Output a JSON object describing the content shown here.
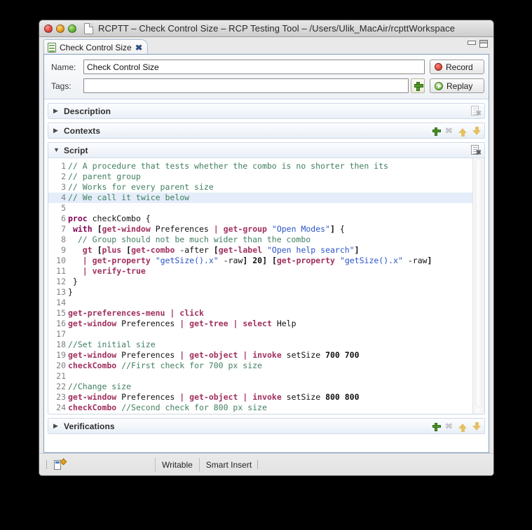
{
  "window": {
    "title": "RCPTT – Check Control Size – RCP Testing Tool – /Users/Ulik_MacAir/rcpttWorkspace",
    "doc_icon": "document-icon",
    "traffic_lights": [
      "close-button",
      "minimize-button",
      "maximize-button"
    ]
  },
  "tab": {
    "label": "Check Control Size",
    "icon": "test-case-document-icon",
    "close": "✖",
    "minimize_icon": "minimize-icon",
    "maximize_icon": "maximize-icon"
  },
  "form": {
    "name_label": "Name:",
    "name_value": "Check Control Size",
    "name_placeholder": "",
    "tags_label": "Tags:",
    "tags_value": "",
    "tags_placeholder": "",
    "add_tag_icon": "plus-icon",
    "record_label": "Record",
    "replay_label": "Replay"
  },
  "sections": [
    {
      "id": "description",
      "title": "Description",
      "expanded": false,
      "twisty": "▶"
    },
    {
      "id": "contexts",
      "title": "Contexts",
      "expanded": false,
      "twisty": "▶"
    },
    {
      "id": "script",
      "title": "Script",
      "expanded": true,
      "twisty": "▼"
    },
    {
      "id": "verifications",
      "title": "Verifications",
      "expanded": false,
      "twisty": "▶"
    }
  ],
  "toolbar_icons": {
    "add": "plus-icon",
    "remove": "x-icon",
    "move_up": "arrow-up-icon",
    "move_down": "arrow-down-icon",
    "clear_doc": "document-remove-icon",
    "remove_glyph": "✖"
  },
  "statusbar": {
    "widget_icon": "control-widget-icon",
    "writable": "Writable",
    "insert_mode": "Smart Insert"
  },
  "colors": {
    "accent_border": "#7e9fc6",
    "comment": "#3f7f5f",
    "keyword": "#7f0055",
    "command": "#a0305f",
    "string": "#2a54c8",
    "current_line": "#e4edf9",
    "record": "#df4b41",
    "replay": "#8cc466",
    "add": "#4f9b28",
    "arrow": "#e6c063"
  },
  "script": {
    "current_line": 4,
    "lines": [
      {
        "n": 1,
        "tokens": [
          {
            "t": "// A procedure that tests whether the combo is no shorter then its",
            "c": "cm"
          }
        ]
      },
      {
        "n": 2,
        "tokens": [
          {
            "t": "// parent group",
            "c": "cm"
          }
        ]
      },
      {
        "n": 3,
        "tokens": [
          {
            "t": "// Works for every parent size",
            "c": "cm"
          }
        ]
      },
      {
        "n": 4,
        "tokens": [
          {
            "t": "// We call it twice below",
            "c": "cm"
          }
        ]
      },
      {
        "n": 5,
        "tokens": []
      },
      {
        "n": 6,
        "tokens": [
          {
            "t": "proc",
            "c": "kw"
          },
          {
            "t": " checkCombo {",
            "c": "ctext"
          }
        ]
      },
      {
        "n": 7,
        "tokens": [
          {
            "t": " ",
            "c": "ctext"
          },
          {
            "t": "with",
            "c": "kw"
          },
          {
            "t": " ",
            "c": "ctext"
          },
          {
            "t": "[",
            "c": "br"
          },
          {
            "t": "get-window",
            "c": "cmd"
          },
          {
            "t": " Preferences ",
            "c": "ctext"
          },
          {
            "t": "|",
            "c": "pipe"
          },
          {
            "t": " ",
            "c": "ctext"
          },
          {
            "t": "get-group",
            "c": "cmd"
          },
          {
            "t": " ",
            "c": "ctext"
          },
          {
            "t": "\"Open Modes\"",
            "c": "str"
          },
          {
            "t": "]",
            "c": "br"
          },
          {
            "t": " {",
            "c": "ctext"
          }
        ]
      },
      {
        "n": 8,
        "tokens": [
          {
            "t": "  // Group should not be much wider than the combo",
            "c": "cm"
          }
        ]
      },
      {
        "n": 9,
        "tokens": [
          {
            "t": "   ",
            "c": "ctext"
          },
          {
            "t": "gt",
            "c": "cmd"
          },
          {
            "t": " ",
            "c": "ctext"
          },
          {
            "t": "[",
            "c": "br"
          },
          {
            "t": "plus",
            "c": "cmd"
          },
          {
            "t": " ",
            "c": "ctext"
          },
          {
            "t": "[",
            "c": "br"
          },
          {
            "t": "get-combo",
            "c": "cmd"
          },
          {
            "t": " -after ",
            "c": "ctext"
          },
          {
            "t": "[",
            "c": "br"
          },
          {
            "t": "get-label",
            "c": "cmd"
          },
          {
            "t": " ",
            "c": "ctext"
          },
          {
            "t": "\"Open help search\"",
            "c": "str"
          },
          {
            "t": "]",
            "c": "br"
          }
        ]
      },
      {
        "n": 10,
        "tokens": [
          {
            "t": "   ",
            "c": "ctext"
          },
          {
            "t": "|",
            "c": "pipe"
          },
          {
            "t": " ",
            "c": "ctext"
          },
          {
            "t": "get-property",
            "c": "cmd"
          },
          {
            "t": " ",
            "c": "ctext"
          },
          {
            "t": "\"getSize().x\"",
            "c": "str"
          },
          {
            "t": " -raw",
            "c": "ctext"
          },
          {
            "t": "]",
            "c": "br"
          },
          {
            "t": " ",
            "c": "ctext"
          },
          {
            "t": "20",
            "c": "num"
          },
          {
            "t": "]",
            "c": "br"
          },
          {
            "t": " ",
            "c": "ctext"
          },
          {
            "t": "[",
            "c": "br"
          },
          {
            "t": "get-property",
            "c": "cmd"
          },
          {
            "t": " ",
            "c": "ctext"
          },
          {
            "t": "\"getSize().x\"",
            "c": "str"
          },
          {
            "t": " -raw",
            "c": "ctext"
          },
          {
            "t": "]",
            "c": "br"
          }
        ]
      },
      {
        "n": 11,
        "tokens": [
          {
            "t": "   ",
            "c": "ctext"
          },
          {
            "t": "|",
            "c": "pipe"
          },
          {
            "t": " ",
            "c": "ctext"
          },
          {
            "t": "verify-true",
            "c": "cmd"
          }
        ]
      },
      {
        "n": 12,
        "tokens": [
          {
            "t": " }",
            "c": "ctext"
          }
        ]
      },
      {
        "n": 13,
        "tokens": [
          {
            "t": "}",
            "c": "ctext"
          }
        ]
      },
      {
        "n": 14,
        "tokens": []
      },
      {
        "n": 15,
        "tokens": [
          {
            "t": "get-preferences-menu",
            "c": "cmd"
          },
          {
            "t": " ",
            "c": "ctext"
          },
          {
            "t": "|",
            "c": "pipe"
          },
          {
            "t": " ",
            "c": "ctext"
          },
          {
            "t": "click",
            "c": "cmd"
          }
        ]
      },
      {
        "n": 16,
        "tokens": [
          {
            "t": "get-window",
            "c": "cmd"
          },
          {
            "t": " Preferences ",
            "c": "ctext"
          },
          {
            "t": "|",
            "c": "pipe"
          },
          {
            "t": " ",
            "c": "ctext"
          },
          {
            "t": "get-tree",
            "c": "cmd"
          },
          {
            "t": " ",
            "c": "ctext"
          },
          {
            "t": "|",
            "c": "pipe"
          },
          {
            "t": " ",
            "c": "ctext"
          },
          {
            "t": "select",
            "c": "cmd"
          },
          {
            "t": " Help",
            "c": "ctext"
          }
        ]
      },
      {
        "n": 17,
        "tokens": []
      },
      {
        "n": 18,
        "tokens": [
          {
            "t": "//Set initial size",
            "c": "cm"
          }
        ]
      },
      {
        "n": 19,
        "tokens": [
          {
            "t": "get-window",
            "c": "cmd"
          },
          {
            "t": " Preferences ",
            "c": "ctext"
          },
          {
            "t": "|",
            "c": "pipe"
          },
          {
            "t": " ",
            "c": "ctext"
          },
          {
            "t": "get-object",
            "c": "cmd"
          },
          {
            "t": " ",
            "c": "ctext"
          },
          {
            "t": "|",
            "c": "pipe"
          },
          {
            "t": " ",
            "c": "ctext"
          },
          {
            "t": "invoke",
            "c": "cmd"
          },
          {
            "t": " setSize ",
            "c": "ctext"
          },
          {
            "t": "700 700",
            "c": "num"
          }
        ]
      },
      {
        "n": 20,
        "tokens": [
          {
            "t": "checkCombo",
            "c": "cmd"
          },
          {
            "t": " ",
            "c": "ctext"
          },
          {
            "t": "//First check for 700 px size",
            "c": "cm"
          }
        ]
      },
      {
        "n": 21,
        "tokens": []
      },
      {
        "n": 22,
        "tokens": [
          {
            "t": "//Change size",
            "c": "cm"
          }
        ]
      },
      {
        "n": 23,
        "tokens": [
          {
            "t": "get-window",
            "c": "cmd"
          },
          {
            "t": " Preferences ",
            "c": "ctext"
          },
          {
            "t": "|",
            "c": "pipe"
          },
          {
            "t": " ",
            "c": "ctext"
          },
          {
            "t": "get-object",
            "c": "cmd"
          },
          {
            "t": " ",
            "c": "ctext"
          },
          {
            "t": "|",
            "c": "pipe"
          },
          {
            "t": " ",
            "c": "ctext"
          },
          {
            "t": "invoke",
            "c": "cmd"
          },
          {
            "t": " setSize ",
            "c": "ctext"
          },
          {
            "t": "800 800",
            "c": "num"
          }
        ]
      },
      {
        "n": 24,
        "tokens": [
          {
            "t": "checkCombo",
            "c": "cmd"
          },
          {
            "t": " ",
            "c": "ctext"
          },
          {
            "t": "//Second check for 800 px size",
            "c": "cm"
          }
        ]
      }
    ]
  }
}
